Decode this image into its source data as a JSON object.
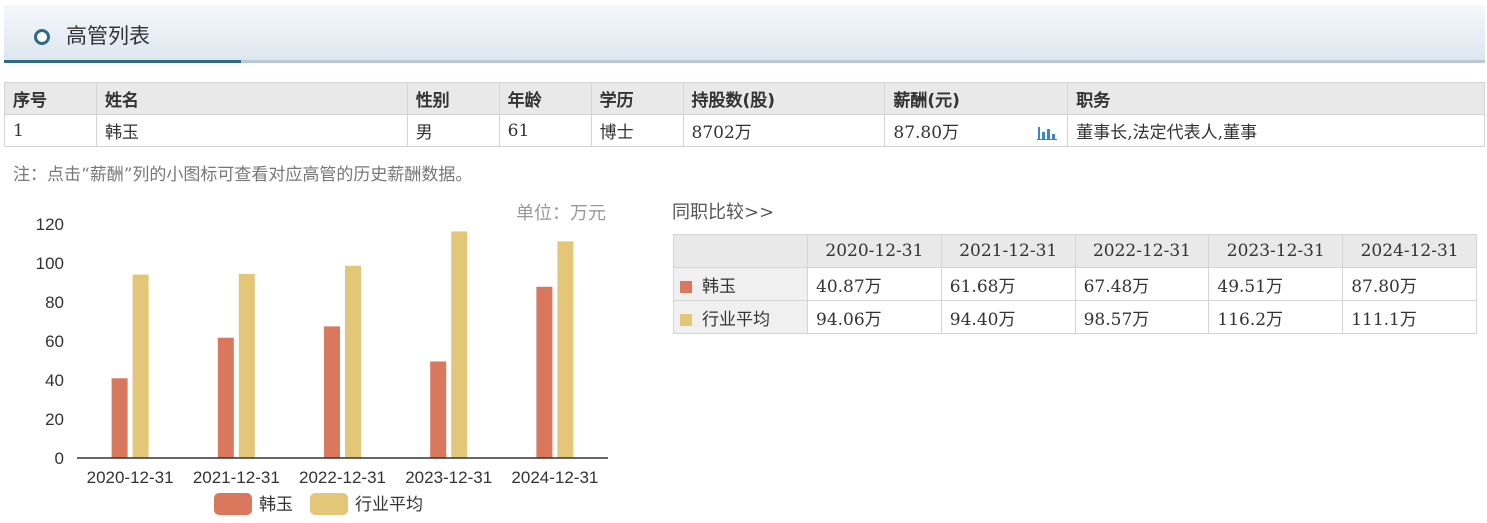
{
  "header": {
    "title": "高管列表"
  },
  "exec_table": {
    "columns": [
      "序号",
      "姓名",
      "性别",
      "年龄",
      "学历",
      "持股数(股)",
      "薪酬(元)",
      "职务"
    ],
    "rows": [
      {
        "index": "1",
        "name": "韩玉",
        "gender": "男",
        "age": "61",
        "education": "博士",
        "shares": "8702万",
        "salary": "87.80万",
        "position": "董事长,法定代表人,董事"
      }
    ]
  },
  "note": "注：点击“薪酬”列的小图标可查看对应高管的历史薪酬数据。",
  "colors": {
    "person": "#d9785c",
    "industry": "#e4c679",
    "accent": "#2f6a86",
    "chart_icon": "#3a86c8"
  },
  "chart_data": {
    "type": "bar",
    "unit_label": "单位：万元",
    "categories": [
      "2020-12-31",
      "2021-12-31",
      "2022-12-31",
      "2023-12-31",
      "2024-12-31"
    ],
    "series": [
      {
        "name": "韩玉",
        "values": [
          40.87,
          61.68,
          67.48,
          49.51,
          87.8
        ]
      },
      {
        "name": "行业平均",
        "values": [
          94.06,
          94.4,
          98.57,
          116.2,
          111.1
        ]
      }
    ],
    "ylim": [
      0,
      120
    ],
    "yticks": [
      0,
      20,
      40,
      60,
      80,
      100,
      120
    ],
    "legend_position": "bottom"
  },
  "compare": {
    "link_label": "同职比较>>",
    "columns": [
      "2020-12-31",
      "2021-12-31",
      "2022-12-31",
      "2023-12-31",
      "2024-12-31"
    ],
    "rows": [
      {
        "label": "韩玉",
        "values": [
          "40.87万",
          "61.68万",
          "67.48万",
          "49.51万",
          "87.80万"
        ]
      },
      {
        "label": "行业平均",
        "values": [
          "94.06万",
          "94.40万",
          "98.57万",
          "116.2万",
          "111.1万"
        ]
      }
    ]
  }
}
